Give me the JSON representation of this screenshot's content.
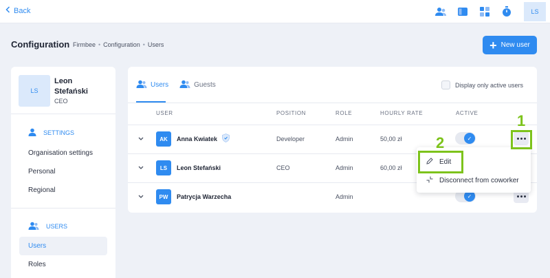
{
  "topbar": {
    "back_label": "Back",
    "icons": [
      "users-icon",
      "panel-icon",
      "grid-icon",
      "stopwatch-icon"
    ],
    "avatar_initials": "LS"
  },
  "header": {
    "title": "Configuration",
    "breadcrumb": [
      "Firmbee",
      "Configuration",
      "Users"
    ],
    "breadcrumb_sep": "•",
    "new_user_label": "New user"
  },
  "profile": {
    "initials": "LS",
    "first_name": "Leon",
    "last_name": "Stefański",
    "role": "CEO"
  },
  "sidebar": {
    "settings_label": "SETTINGS",
    "settings_items": [
      {
        "label": "Organisation settings"
      },
      {
        "label": "Personal"
      },
      {
        "label": "Regional"
      }
    ],
    "users_label": "USERS",
    "users_items": [
      {
        "label": "Users",
        "active": true
      },
      {
        "label": "Roles",
        "active": false
      }
    ]
  },
  "tabs": [
    {
      "label": "Users",
      "active": true
    },
    {
      "label": "Guests",
      "active": false
    }
  ],
  "filter_label": "Display only active users",
  "table": {
    "headers": [
      "USER",
      "POSITION",
      "ROLE",
      "HOURLY RATE",
      "ACTIVE"
    ],
    "rows": [
      {
        "initials": "AK",
        "name": "Anna Kwiatek",
        "position": "Developer",
        "role": "Admin",
        "rate": "50,00 zł",
        "active": true,
        "shield": true
      },
      {
        "initials": "LS",
        "name": "Leon Stefański",
        "position": "CEO",
        "role": "Admin",
        "rate": "60,00 zł",
        "active": true,
        "shield": false
      },
      {
        "initials": "PW",
        "name": "Patrycja Warzecha",
        "position": "",
        "role": "Admin",
        "rate": "",
        "active": true,
        "shield": false
      }
    ]
  },
  "dropdown": {
    "edit_label": "Edit",
    "disconnect_label": "Disconnect from coworker"
  },
  "annotations": {
    "step1": "1",
    "step2": "2"
  },
  "colors": {
    "accent": "#2f8bf0",
    "highlight": "#7dc31b",
    "background": "#eef1f7"
  }
}
